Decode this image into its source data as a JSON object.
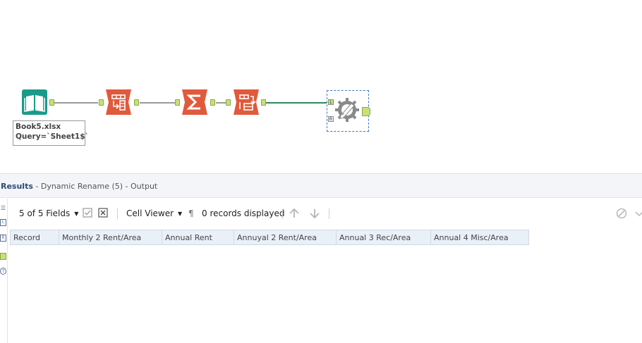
{
  "workflow": {
    "input_annotation": {
      "line1": "Book5.xlsx",
      "line2": "Query=`Sheet1$`"
    },
    "anchor_labels": {
      "left": "L",
      "right": "R"
    },
    "tools": [
      {
        "name": "input-data",
        "icon": "book-icon",
        "color": "#1a9b8a"
      },
      {
        "name": "select",
        "icon": "select-icon",
        "color": "#e05a3c"
      },
      {
        "name": "summarize",
        "icon": "sigma-icon",
        "color": "#e05a3c"
      },
      {
        "name": "transpose",
        "icon": "transpose-icon",
        "color": "#e05a3c"
      },
      {
        "name": "dynamic-rename",
        "icon": "gear-pencil-icon",
        "color": "#8a8a8a"
      }
    ]
  },
  "results": {
    "title": "Results",
    "subtitle": " - Dynamic Rename (5) - Output",
    "toolbar": {
      "fields": "5 of 5 Fields",
      "cell_viewer": "Cell Viewer",
      "pilcrow": "¶",
      "records": "0 records displayed"
    },
    "rail": [
      "☰",
      "L",
      "R",
      "",
      "?"
    ],
    "columns": [
      "Record",
      "Monthly 2 Rent/Area",
      "Annual Rent",
      "Annuyal 2 Rent/Area",
      "Annual 3 Rec/Area",
      "Annual 4 Misc/Area"
    ]
  },
  "colors": {
    "teal": "#1a9b8a",
    "orange": "#e05a3c",
    "anchor_green": "#c8e07a",
    "header_blue": "#2d4a7a",
    "column_bg": "#eaf0f8"
  }
}
